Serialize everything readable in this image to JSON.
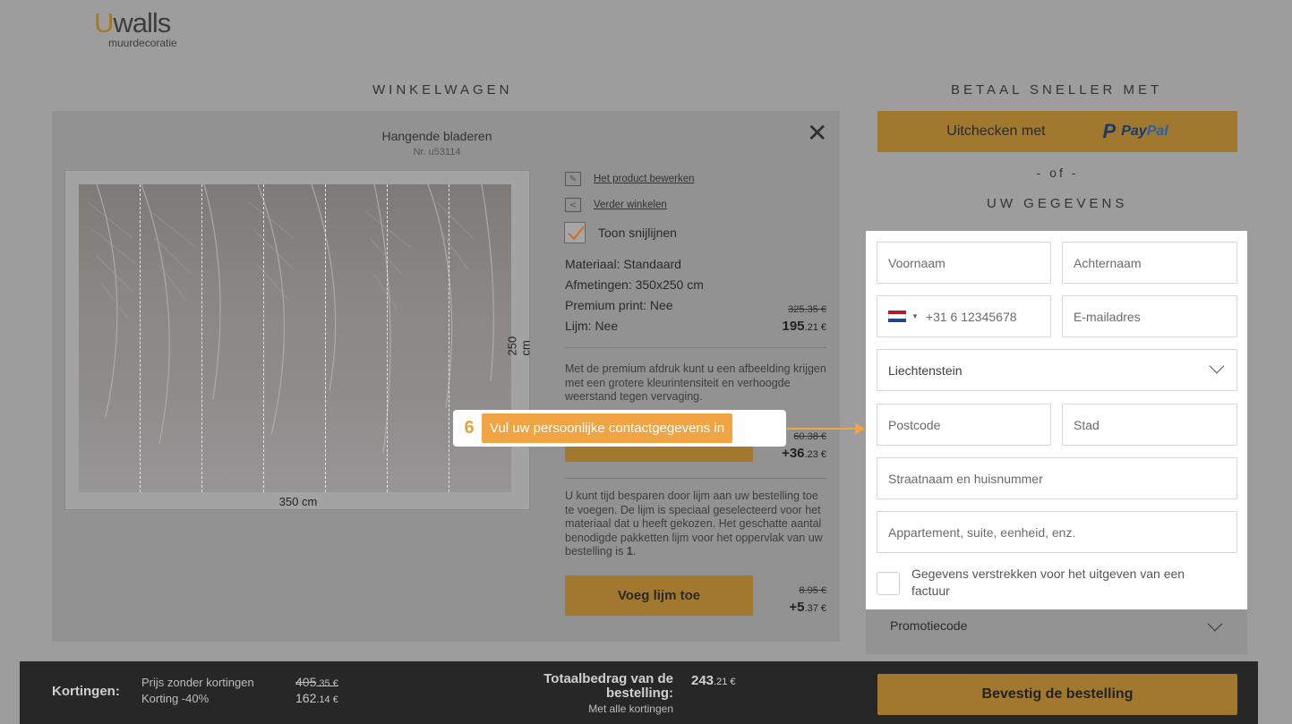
{
  "logo": {
    "brand_u": "U",
    "brand_rest": "walls",
    "subtitle": "muurdecoratie"
  },
  "cart": {
    "title": "WINKELWAGEN",
    "product_name": "Hangende bladeren",
    "product_nr": "Nr. u53114",
    "dim_width": "350  cm",
    "dim_height": "250  cm",
    "link_edit": "Het product bewerken",
    "link_continue": "Verder winkelen",
    "show_cutlines": "Toon snijlijnen",
    "specs": {
      "material": "Materiaal: Standaard",
      "dimensions": "Afmetingen: 350x250 cm",
      "premium": "Premium print: Nee",
      "glue": "Lijm: Nee"
    },
    "price_old": "325.35 €",
    "price_new_main": "195",
    "price_new_dec": ".21 €",
    "premium_desc": "Met de premium afdruk kunt u een afbeelding krijgen met een grotere kleurintensiteit en verhoogde weerstand tegen vervaging.",
    "premium_old": "60.38 €",
    "premium_new_main": "+36",
    "premium_new_dec": ".23 €",
    "glue_desc_1": "U kunt tijd besparen door lijm aan uw bestelling toe te voegen. De lijm is speciaal geselecteerd voor het materiaal dat u heeft gekozen. Het geschatte aantal benodigde pakketten lijm voor het oppervlak van uw bestelling is ",
    "glue_desc_count": "1",
    "glue_desc_end": ".",
    "add_glue_button": "Voeg lijm toe",
    "glue_old": "8.95 €",
    "glue_new_main": "+5",
    "glue_new_dec": ".37 €"
  },
  "checkout": {
    "title": "BETAAL SNELLER MET",
    "paypal_label": "Uitchecken met",
    "paypal_pay": "Pay",
    "paypal_pal": "Pal",
    "or": "- of -",
    "details_title": "UW GEGEVENS",
    "fields": {
      "firstname": "Voornaam",
      "lastname": "Achternaam",
      "phone": "+31 6 12345678",
      "email": "E-mailadres",
      "country": "Liechtenstein",
      "postcode": "Postcode",
      "city": "Stad",
      "street": "Straatnaam en huisnummer",
      "apartment": "Appartement, suite, eenheid, enz."
    },
    "invoice_label": "Gegevens verstrekken voor het uitgeven van een factuur",
    "promo": "Promotiecode"
  },
  "tooltip": {
    "step": "6",
    "text": "Vul uw persoonlijke contactgegevens in"
  },
  "bottom": {
    "discounts_label": "Kortingen:",
    "price_without_label": "Prijs zonder kortingen",
    "discount_label": "Korting -40%",
    "price_without_main": "405",
    "price_without_dec": ".35 €",
    "discount_main": "162",
    "discount_dec": ".14 €",
    "total_label": "Totaalbedrag van de bestelling:",
    "total_sub": "Met alle kortingen",
    "total_main": "243",
    "total_dec": ".21 €",
    "confirm_button": "Bevestig de bestelling"
  },
  "colors": {
    "accent": "#f0a444",
    "gold": "#a2772e",
    "paypal_blue": "#1e3867"
  }
}
